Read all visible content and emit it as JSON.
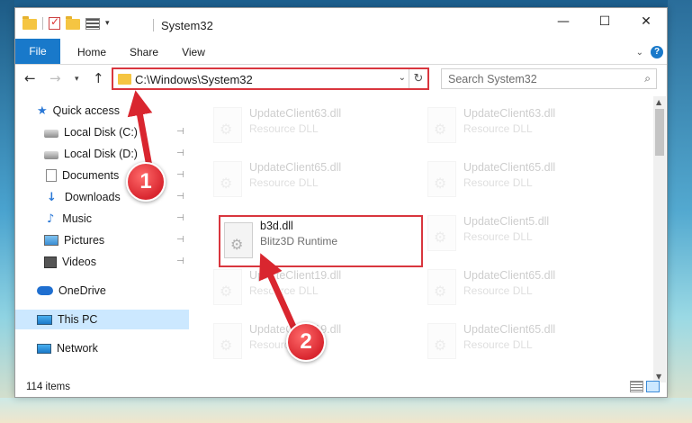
{
  "window": {
    "title": "System32",
    "controls": {
      "minimize": "—",
      "maximize": "☐",
      "close": "✕"
    }
  },
  "ribbon": {
    "tabs": [
      {
        "label": "File"
      },
      {
        "label": "Home"
      },
      {
        "label": "Share"
      },
      {
        "label": "View"
      }
    ],
    "help": "?"
  },
  "navigation": {
    "back": "←",
    "forward": "→",
    "recent": "▾",
    "up": "↑"
  },
  "address": {
    "path": "C:\\Windows\\System32",
    "dropdown": "⌄",
    "refresh": "↻"
  },
  "search": {
    "placeholder": "Search System32",
    "icon": "⌕"
  },
  "sidebar": {
    "items": [
      {
        "label": "Quick access",
        "icon": "star-icon"
      },
      {
        "label": "Local Disk (C:)",
        "icon": "drive-icon",
        "pinned": true
      },
      {
        "label": "Local Disk (D:)",
        "icon": "drive-icon",
        "pinned": true
      },
      {
        "label": "Documents",
        "icon": "document-icon",
        "pinned": true
      },
      {
        "label": "Downloads",
        "icon": "download-icon",
        "pinned": true
      },
      {
        "label": "Music",
        "icon": "music-icon",
        "pinned": true
      },
      {
        "label": "Pictures",
        "icon": "pictures-icon",
        "pinned": true
      },
      {
        "label": "Videos",
        "icon": "videos-icon",
        "pinned": true
      },
      {
        "label": "OneDrive",
        "icon": "cloud-icon"
      },
      {
        "label": "This PC",
        "icon": "pc-icon",
        "selected": true
      },
      {
        "label": "Network",
        "icon": "network-icon"
      }
    ],
    "pin_glyph": "📌"
  },
  "files": [
    {
      "name": "UpdateClient63.dll",
      "type": "Resource DLL",
      "faded": true
    },
    {
      "name": "UpdateClient63.dll",
      "type": "Resource DLL",
      "faded": true
    },
    {
      "name": "UpdateClient65.dll",
      "type": "Resource DLL",
      "faded": true
    },
    {
      "name": "UpdateClient65.dll",
      "type": "Resource DLL",
      "faded": true
    },
    {
      "name": "b3d.dll",
      "type": "Blitz3D Runtime",
      "faded": false,
      "highlighted": true
    },
    {
      "name": "UpdateClient5.dll",
      "type": "Resource DLL",
      "faded": true
    },
    {
      "name": "UpdateClient19.dll",
      "type": "Resource DLL",
      "faded": true
    },
    {
      "name": "UpdateClient65.dll",
      "type": "Resource DLL",
      "faded": true
    },
    {
      "name": "UpdateClient19.dll",
      "type": "Resource DLL",
      "faded": true
    },
    {
      "name": "UpdateClient65.dll",
      "type": "Resource DLL",
      "faded": true
    }
  ],
  "status": {
    "item_count": "114 items"
  },
  "callouts": [
    {
      "number": "1"
    },
    {
      "number": "2"
    }
  ],
  "colors": {
    "accent": "#1979ca",
    "highlight_border": "#d9363e",
    "selected_bg": "#cce8ff"
  }
}
